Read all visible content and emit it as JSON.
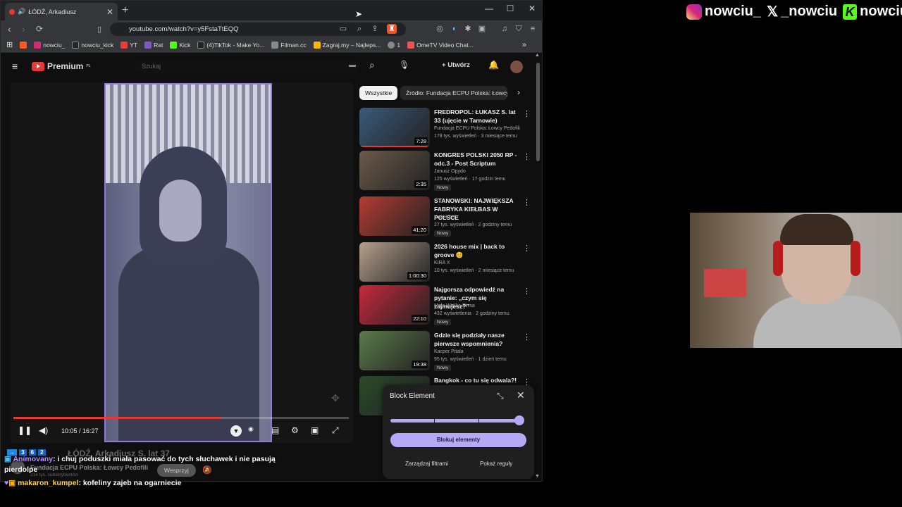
{
  "tab": {
    "title": "ŁÓDŹ, Arkadiusz",
    "close": "✕",
    "new": "+"
  },
  "window": {
    "minimize": "—",
    "maximize": "☐",
    "close": "✕"
  },
  "address": {
    "url": "youtube.com/watch?v=y5FstaTtEQQ"
  },
  "bookmarks": [
    {
      "label": "",
      "color": "#ff5722"
    },
    {
      "label": "nowciu_",
      "color": "#d62976"
    },
    {
      "label": "nowciu_kick",
      "color": "#222"
    },
    {
      "label": "YT",
      "color": "#e53935"
    },
    {
      "label": "Rat",
      "color": "#7e57c2"
    },
    {
      "label": "Kick",
      "color": "#53fc18"
    },
    {
      "label": "(4)TikTok - Make Yo...",
      "color": "#222"
    },
    {
      "label": "Filman.cc",
      "color": "#888"
    },
    {
      "label": "Zagraj.my – Najleps...",
      "color": "#ffb300"
    },
    {
      "label": "1",
      "color": "#888"
    },
    {
      "label": "OmeTV Video Chat...",
      "color": "#ef5350"
    }
  ],
  "youtube": {
    "logo": "Premium",
    "logo_sup": "PL",
    "search_placeholder": "Szukaj",
    "create": "Utwórz",
    "time": "10:05 / 16:27",
    "chips": [
      "Wszystkie",
      "Źródło: Fundacja ECPU Polska: Łowcy Pedofili"
    ],
    "videos": [
      {
        "title": "FREDROPOL: ŁUKASZ S. lat 33 (ujęcie w Tarnowie)",
        "channel": "Fundacja ECPU Polska: Łowcy Pedofili",
        "meta": "178 tys. wyświetleń · 3 miesiące temu",
        "duration": "7:28",
        "badge": "",
        "color": "#3a5a7a"
      },
      {
        "title": "KONGRES POLSKI 2050 RP - odc.3 - Post Scriptum",
        "channel": "Janusz Opydo",
        "meta": "125 wyświetleń · 17 godzin temu",
        "duration": "2:35",
        "badge": "Nowy",
        "color": "#6a5a4a"
      },
      {
        "title": "STANOWSKI: NAJWIĘKSZA FABRYKA KIEŁBAS W POLSCE",
        "channel": "Kanał Zero",
        "meta": "27 tys. wyświetleń · 2 godziny temu",
        "duration": "41:20",
        "badge": "Nowy",
        "color": "#b43c32"
      },
      {
        "title": "2026 house mix | back to groove 😊",
        "channel": "KIRA X",
        "meta": "10 tys. wyświetleń · 2 miesiące temu",
        "duration": "1:00:30",
        "badge": "",
        "color": "#b4a08c"
      },
      {
        "title": "Najgorsza odpowiedź na pytanie: „czym się zajmujesz?”",
        "channel": "Mała Wielka Firma",
        "meta": "432 wyświetlenia · 2 godziny temu",
        "duration": "22:10",
        "badge": "Nowy",
        "color": "#c8283c"
      },
      {
        "title": "Gdzie się podziały nasze pierwsze wspomnienia?",
        "channel": "Kacper Pitala",
        "meta": "95 tys. wyświetleń · 1 dzień temu",
        "duration": "19:38",
        "badge": "Nowy",
        "color": "#5a7a4a"
      },
      {
        "title": "Bangkok - co tu się odwala?!",
        "channel": "",
        "meta": "",
        "duration": "",
        "badge": "",
        "color": "#2a4a2a"
      }
    ],
    "below_title": "ŁÓDŹ, Arkadiusz S. lat 37",
    "below_channel": "Fundacja ECPU Polska: Łowcy Pedofili",
    "below_subs": "214 tys. subskrybentów",
    "support": "Wesprzyj"
  },
  "block_panel": {
    "title": "Block Element",
    "main_button": "Blokuj elementy",
    "filters": "Zarządzaj filtrami",
    "rules": "Pokaż reguły",
    "slider_value": 1.0
  },
  "chat": [
    {
      "user": "Animovany",
      "message": ": i chuj poduszki miała pasować do tych słuchawek i nie pasują"
    },
    {
      "user": "",
      "message": "pierdolpe"
    },
    {
      "user": "makaron_kumpel",
      "message": ": kofeliny zajeb na ogarniecie"
    }
  ],
  "socials": {
    "instagram": "nowciu_",
    "x": "_nowciu",
    "kick": "nowciu"
  }
}
